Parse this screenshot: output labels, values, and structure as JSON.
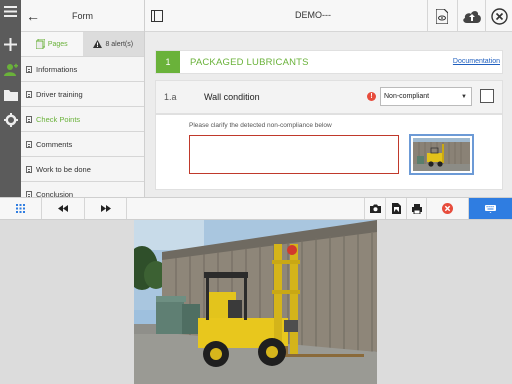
{
  "form_panel": {
    "title": "Form",
    "tabs": [
      {
        "label": "Pages",
        "active": true
      },
      {
        "label": "8 alert(s)",
        "active": false
      }
    ],
    "pages": [
      {
        "label": "Informations",
        "active": false
      },
      {
        "label": "Driver training",
        "active": false
      },
      {
        "label": "Check Points",
        "active": true
      },
      {
        "label": "Comments",
        "active": false
      },
      {
        "label": "Work to be done",
        "active": false
      },
      {
        "label": "Conclusion",
        "active": false
      }
    ]
  },
  "topbar": {
    "doc_title": "DEMO---"
  },
  "section": {
    "number": "1",
    "name": "PACKAGED LUBRICANTS",
    "doc_link": "Documentation"
  },
  "question": {
    "number": "1.a",
    "label": "Wall condition",
    "warn_symbol": "!",
    "selected_value": "Non-compliant",
    "checked": false
  },
  "detail": {
    "hint": "Please clarify the detected non-compliance below",
    "textarea_value": ""
  },
  "colors": {
    "accent_green": "#6ab23a",
    "rail": "#5b5b5b",
    "error_red": "#e74c3c",
    "primary_blue": "#2f7de1",
    "link_blue": "#1f5fbf"
  },
  "icons": {
    "rail": [
      "menu-icon",
      "plus-icon",
      "user-icon",
      "folder-icon",
      "gear-icon"
    ],
    "topbar": [
      "eye-document-icon",
      "cloud-upload-icon",
      "close-circle-icon"
    ],
    "toolbar": [
      "grid-icon",
      "rewind-icon",
      "fast-forward-icon",
      "camera-icon",
      "image-file-icon",
      "printer-icon",
      "delete-icon",
      "keyboard-icon"
    ]
  }
}
